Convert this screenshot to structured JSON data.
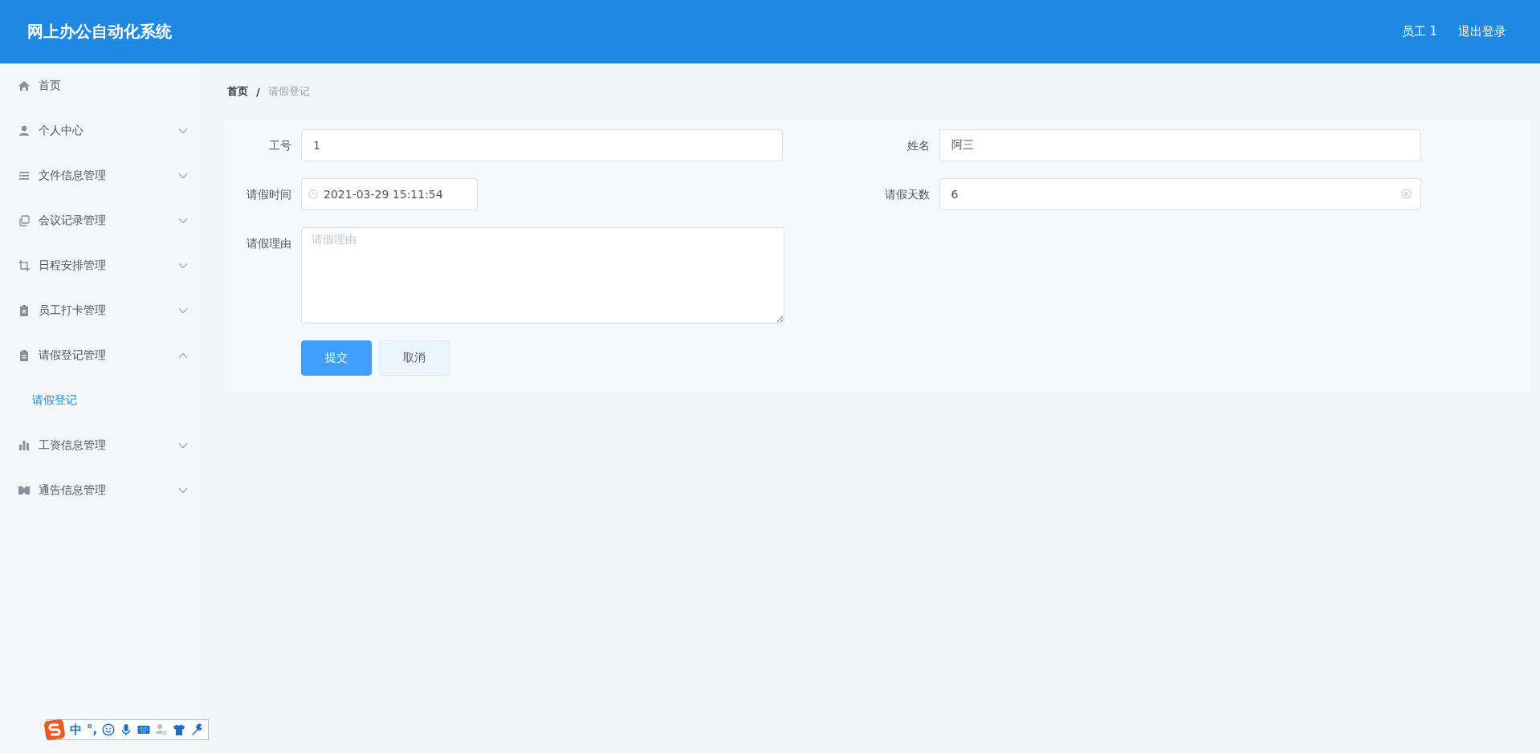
{
  "header": {
    "title": "网上办公自动化系统",
    "user": "员工 1",
    "logout": "退出登录"
  },
  "sidebar": {
    "items": [
      {
        "label": "首页",
        "kind": "link"
      },
      {
        "label": "个人中心",
        "kind": "submenu",
        "expanded": false
      },
      {
        "label": "文件信息管理",
        "kind": "submenu",
        "expanded": false
      },
      {
        "label": "会议记录管理",
        "kind": "submenu",
        "expanded": false
      },
      {
        "label": "日程安排管理",
        "kind": "submenu",
        "expanded": false
      },
      {
        "label": "员工打卡管理",
        "kind": "submenu",
        "expanded": false
      },
      {
        "label": "请假登记管理",
        "kind": "submenu",
        "expanded": true,
        "children": [
          {
            "label": "请假登记",
            "selected": true
          }
        ]
      },
      {
        "label": "工资信息管理",
        "kind": "submenu",
        "expanded": false
      },
      {
        "label": "通告信息管理",
        "kind": "submenu",
        "expanded": false
      }
    ]
  },
  "breadcrumb": {
    "separator": "/",
    "items": [
      {
        "label": "首页",
        "current": false
      },
      {
        "label": "请假登记",
        "current": true
      }
    ]
  },
  "form": {
    "fields": [
      {
        "kind": "text",
        "label": "工号",
        "value": "1",
        "clearable": false
      },
      {
        "kind": "text",
        "label": "姓名",
        "value": "阿三",
        "clearable": false
      },
      {
        "kind": "datetime",
        "label": "请假时间",
        "value": "2021-03-29 15:11:54"
      },
      {
        "kind": "text",
        "label": "请假天数",
        "value": "6",
        "clearable": true
      },
      {
        "kind": "textarea",
        "label": "请假理由",
        "placeholder": "请假理由"
      }
    ],
    "buttons": [
      {
        "label": "提交",
        "kind": "primary"
      },
      {
        "label": "取消",
        "kind": "default"
      }
    ]
  },
  "ime_toolbar": {
    "mode": "中",
    "punctuation": "°,"
  }
}
